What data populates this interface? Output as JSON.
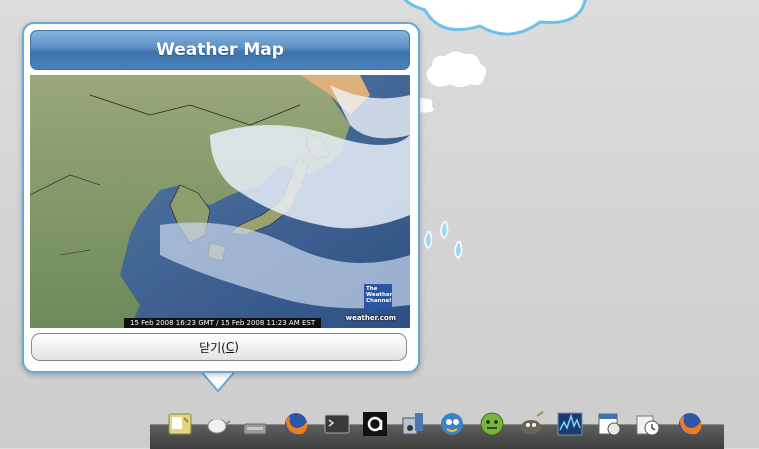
{
  "popup": {
    "title": "Weather Map",
    "close_label_prefix": "닫기(",
    "close_mnemonic": "C",
    "close_label_suffix": ")"
  },
  "map": {
    "caption": "15 Feb 2008 16:23 GMT / 15 Feb 2008 11:23 AM EST",
    "logo_text": "The Weather Channel",
    "logo_url": "weather.com"
  },
  "dock": {
    "items": [
      {
        "name": "notes-app-icon"
      },
      {
        "name": "teapot-icon"
      },
      {
        "name": "tray-icon"
      },
      {
        "name": "firefox-icon"
      },
      {
        "name": "terminal-icon"
      },
      {
        "name": "amazon-icon"
      },
      {
        "name": "system-tools-icon"
      },
      {
        "name": "messenger-icon"
      },
      {
        "name": "android-icon"
      },
      {
        "name": "gimp-icon"
      },
      {
        "name": "system-monitor-icon"
      },
      {
        "name": "calendar-clock-icon"
      },
      {
        "name": "clock-icon"
      },
      {
        "name": "firefox-browser-icon"
      }
    ]
  },
  "colors": {
    "accent": "#5d8fc5",
    "popup_border": "#6aa6d8",
    "dock": "#3d3d3d"
  }
}
